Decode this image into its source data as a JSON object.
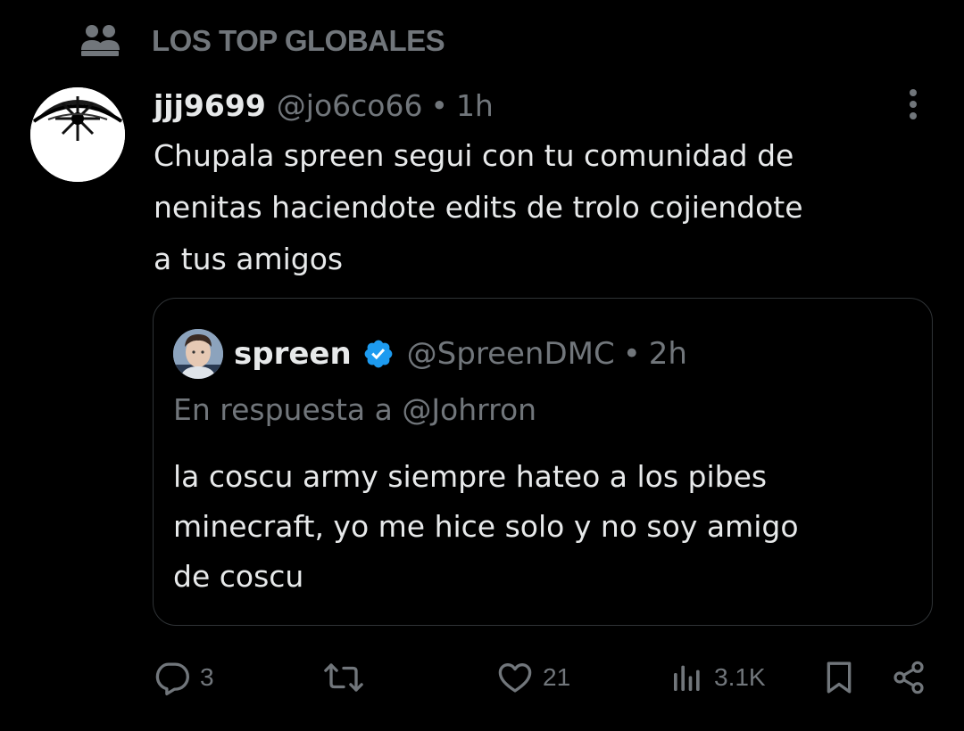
{
  "context": {
    "label": "LOS TOP GLOBALES",
    "icon": "community-icon"
  },
  "tweet": {
    "author_name": "jjj9699",
    "author_handle": "@jo6co66",
    "separator": "•",
    "time": "1h",
    "text": "Chupala spreen segui con tu comunidad de\nnenitas haciendote edits de trolo cojiendote\na tus amigos",
    "more_icon": "more-options-icon"
  },
  "quoted_tweet": {
    "author_name": "spreen",
    "verified": true,
    "author_handle": "@SpreenDMC",
    "separator": "•",
    "time": "2h",
    "reply_to": "En respuesta a @Johrron",
    "text": "la coscu army siempre hateo a los pibes\nminecraft, yo me hice solo y no soy amigo\nde coscu"
  },
  "actions": {
    "replies": "3",
    "retweets": "",
    "likes": "21",
    "views": "3.1K"
  },
  "colors": {
    "background": "#000000",
    "text_primary": "#e7e9ea",
    "text_secondary": "#71767b",
    "border": "#2f3336",
    "verified": "#1d9bf0"
  }
}
